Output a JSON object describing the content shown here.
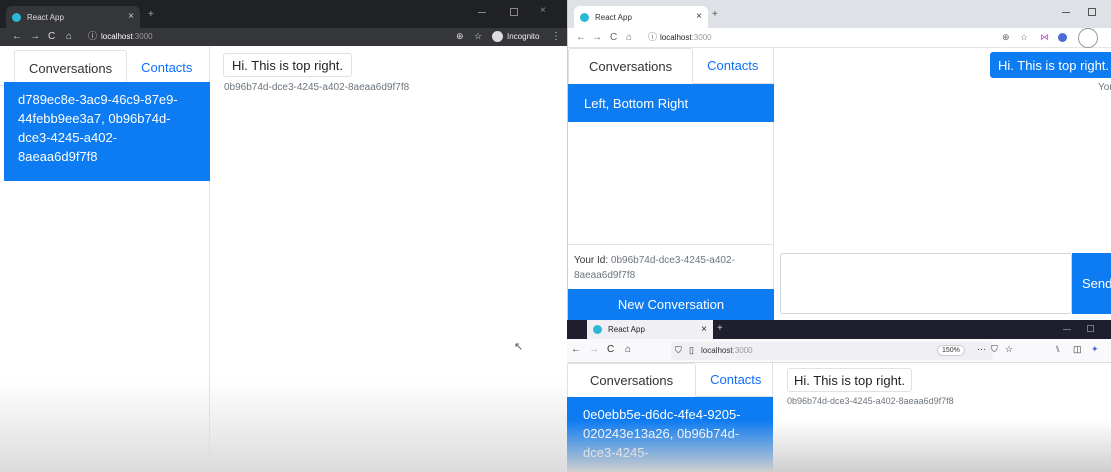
{
  "left_window": {
    "tab_title": "React App",
    "url_host": "localhost",
    "url_port": ":3000",
    "incognito_label": "Incognito",
    "nav": {
      "conversations": "Conversations",
      "contacts": "Contacts"
    },
    "selected_item": "d789ec8e-3ac9-46c9-87e9-44febb9ee3a7, 0b96b74d-dce3-4245-a402-8aeaa6d9f7f8",
    "message": "Hi. This is top right.",
    "message_meta": "0b96b74d-dce3-4245-a402-8aeaa6d9f7f8"
  },
  "top_right_window": {
    "tab_title": "React App",
    "url_host": "localhost",
    "url_port": ":3000",
    "nav": {
      "conversations": "Conversations",
      "contacts": "Contacts"
    },
    "selected_item": "Left, Bottom Right",
    "message": "Hi. This is top right.",
    "sender_meta": "You",
    "your_id_label": "Your Id:",
    "your_id_value": "0b96b74d-dce3-4245-a402-8aeaa6d9f7f8",
    "new_conversation": "New Conversation",
    "send_button": "Send"
  },
  "bottom_right_window": {
    "tab_title": "React App",
    "url_host": "localhost",
    "url_port": ":3000",
    "zoom": "150%",
    "nav": {
      "conversations": "Conversations",
      "contacts": "Contacts"
    },
    "selected_item": "0e0ebb5e-d6dc-4fe4-9205-020243e13a26, 0b96b74d-dce3-4245-",
    "message": "Hi. This is top right.",
    "message_meta": "0b96b74d-dce3-4245-a402-8aeaa6d9f7f8"
  },
  "colors": {
    "accent": "#0d7bf2",
    "chrome_dark": "#202124",
    "chrome_light": "#dee1e6"
  }
}
